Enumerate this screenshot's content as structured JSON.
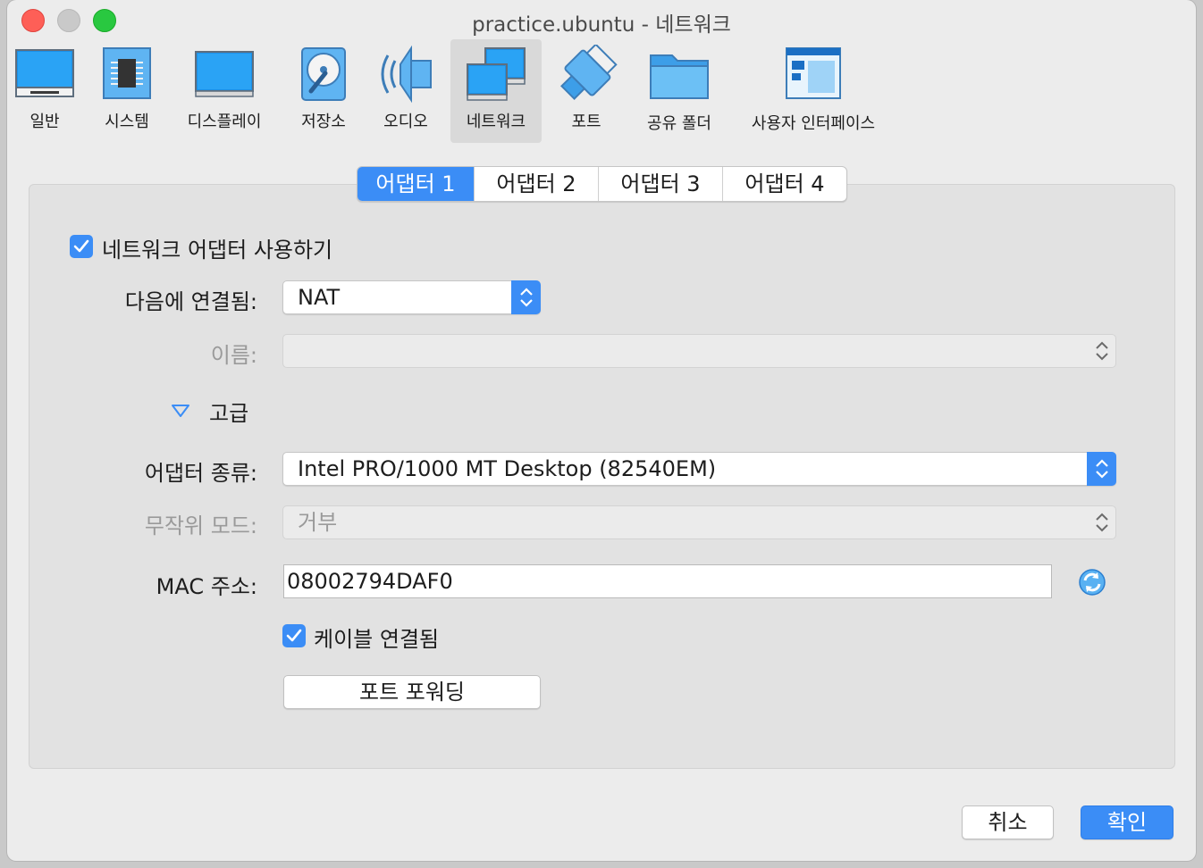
{
  "window": {
    "title": "practice.ubuntu - 네트워크"
  },
  "toolbar": {
    "items": [
      {
        "label": "일반",
        "icon": "general-icon"
      },
      {
        "label": "시스템",
        "icon": "system-icon"
      },
      {
        "label": "디스플레이",
        "icon": "display-icon"
      },
      {
        "label": "저장소",
        "icon": "storage-icon"
      },
      {
        "label": "오디오",
        "icon": "audio-icon"
      },
      {
        "label": "네트워크",
        "icon": "network-icon",
        "active": true
      },
      {
        "label": "포트",
        "icon": "ports-icon"
      },
      {
        "label": "공유 폴더",
        "icon": "shared-folders-icon"
      },
      {
        "label": "사용자 인터페이스",
        "icon": "user-interface-icon"
      }
    ]
  },
  "tabs": [
    {
      "label": "어댑터 1",
      "active": true
    },
    {
      "label": "어댑터 2"
    },
    {
      "label": "어댑터 3"
    },
    {
      "label": "어댑터 4"
    }
  ],
  "form": {
    "enable_adapter": {
      "label": "네트워크 어댑터 사용하기",
      "checked": true
    },
    "attached_to": {
      "label": "다음에 연결됨:",
      "value": "NAT"
    },
    "name": {
      "label": "이름:",
      "value": ""
    },
    "advanced": {
      "label": "고급",
      "expanded": true
    },
    "adapter_type": {
      "label": "어댑터 종류:",
      "value": "Intel PRO/1000 MT Desktop (82540EM)"
    },
    "promiscuous_mode": {
      "label": "무작위 모드:",
      "value": "거부"
    },
    "mac_address": {
      "label": "MAC 주소:",
      "value": "08002794DAF0"
    },
    "cable_connected": {
      "label": "케이블 연결됨",
      "checked": true
    },
    "port_forwarding": {
      "label": "포트 포워딩"
    }
  },
  "footer": {
    "cancel_label": "취소",
    "ok_label": "확인"
  },
  "colors": {
    "accent": "#3b8df6",
    "window_bg": "#ececec",
    "panel_bg": "#e2e2e2"
  }
}
